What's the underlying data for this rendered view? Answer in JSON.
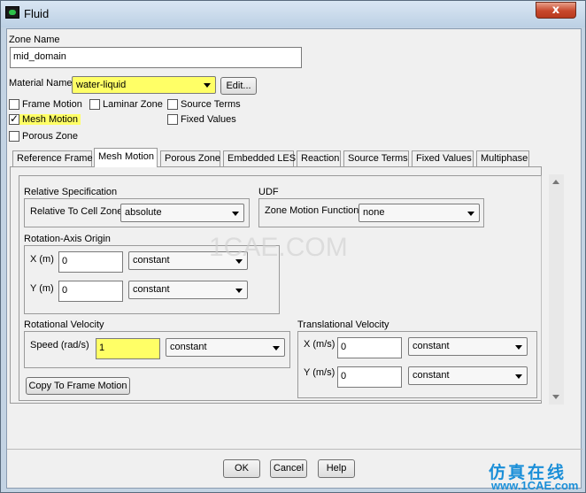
{
  "window": {
    "title": "Fluid",
    "close_glyph": "x"
  },
  "zone": {
    "label": "Zone Name",
    "value": "mid_domain"
  },
  "material": {
    "label": "Material Name",
    "value": "water-liquid",
    "edit_label": "Edit..."
  },
  "options": {
    "frame_motion": "Frame Motion",
    "laminar_zone": "Laminar Zone",
    "source_terms": "Source Terms",
    "mesh_motion": "Mesh Motion",
    "fixed_values": "Fixed Values",
    "porous_zone": "Porous Zone"
  },
  "tabs": [
    "Reference Frame",
    "Mesh Motion",
    "Porous Zone",
    "Embedded LES",
    "Reaction",
    "Source Terms",
    "Fixed Values",
    "Multiphase"
  ],
  "relative": {
    "title": "Relative Specification",
    "label": "Relative To Cell Zone",
    "value": "absolute"
  },
  "udf": {
    "title": "UDF",
    "label": "Zone Motion Function",
    "value": "none"
  },
  "rotation_origin": {
    "title": "Rotation-Axis Origin",
    "x_label": "X (m)",
    "x_value": "0",
    "x_method": "constant",
    "y_label": "Y (m)",
    "y_value": "0",
    "y_method": "constant"
  },
  "rotational_velocity": {
    "title": "Rotational Velocity",
    "speed_label": "Speed (rad/s)",
    "speed_value": "1",
    "speed_method": "constant",
    "copy_button": "Copy To Frame Motion"
  },
  "translational_velocity": {
    "title": "Translational Velocity",
    "x_label": "X (m/s)",
    "x_value": "0",
    "x_method": "constant",
    "y_label": "Y (m/s)",
    "y_value": "0",
    "y_method": "constant"
  },
  "footer": {
    "ok": "OK",
    "cancel": "Cancel",
    "help": "Help"
  },
  "watermark": "1CAE.COM",
  "branding": {
    "cn": "仿真在线",
    "url": "www.1CAE.com"
  },
  "colors": {
    "highlight": "#ffff66",
    "title_bar": "#c3d3e3",
    "close_button": "#c7472b",
    "brand": "#1b8fd8"
  }
}
